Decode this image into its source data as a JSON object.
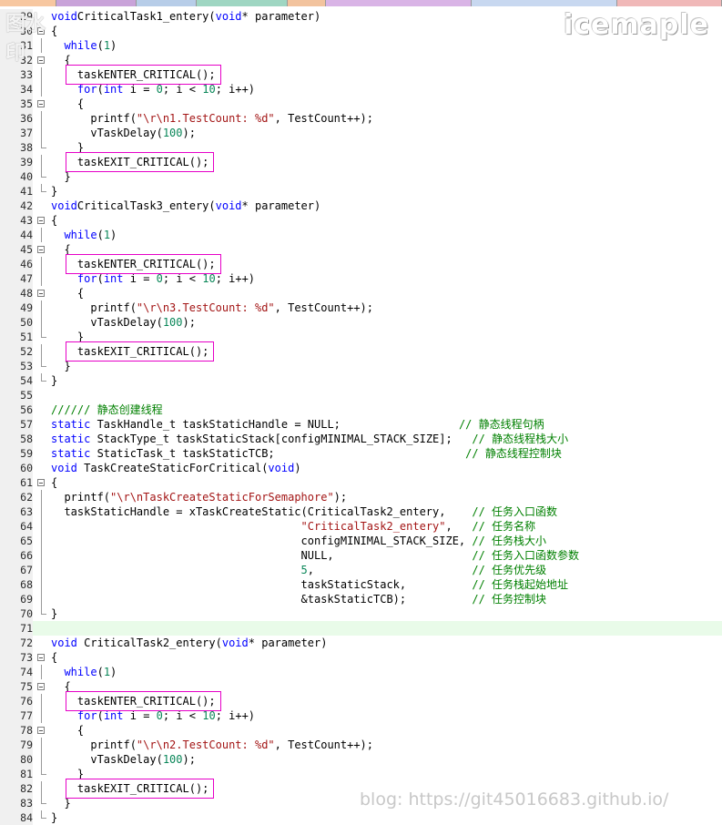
{
  "tabs_colors": [
    "#f7c7a0",
    "#c9a3d9",
    "#b7cde8",
    "#9fd6c2",
    "#f2c39e",
    "#d9b4e6",
    "#c8d8f0",
    "#f0b8b8"
  ],
  "watermark": {
    "logo": "icemaple",
    "corner": "图水印",
    "blog": "blog: https://git45016683.github.io/"
  },
  "highlight_line": 71,
  "lines": [
    {
      "n": "29",
      "fold": "none",
      "code": [
        [
          "kw",
          "void"
        ],
        [
          "",
          "CriticalTask1_entery("
        ],
        [
          "kw",
          "void"
        ],
        [
          "",
          "* parameter)"
        ]
      ]
    },
    {
      "n": "30",
      "fold": "box",
      "code": [
        [
          "",
          "{"
        ]
      ]
    },
    {
      "n": "31",
      "fold": "vl",
      "code": [
        [
          "",
          "  "
        ],
        [
          "kw",
          "while"
        ],
        [
          "",
          "("
        ],
        [
          "num",
          "1"
        ],
        [
          "",
          ")"
        ]
      ]
    },
    {
      "n": "32",
      "fold": "box",
      "code": [
        [
          "",
          "  {"
        ]
      ]
    },
    {
      "n": "33",
      "fold": "vl",
      "code": [
        [
          "",
          "    taskENTER_CRITICAL();"
        ]
      ]
    },
    {
      "n": "34",
      "fold": "vl",
      "code": [
        [
          "",
          "    "
        ],
        [
          "kw",
          "for"
        ],
        [
          "",
          "("
        ],
        [
          "kw",
          "int"
        ],
        [
          "",
          " i = "
        ],
        [
          "num",
          "0"
        ],
        [
          "",
          "; i < "
        ],
        [
          "num",
          "10"
        ],
        [
          "",
          "; i++)"
        ]
      ]
    },
    {
      "n": "35",
      "fold": "box",
      "code": [
        [
          "",
          "    {"
        ]
      ]
    },
    {
      "n": "36",
      "fold": "vl",
      "code": [
        [
          "",
          "      printf("
        ],
        [
          "str",
          "\"\\r\\n1.TestCount: %d\""
        ],
        [
          "",
          ", TestCount++);"
        ]
      ]
    },
    {
      "n": "37",
      "fold": "vl",
      "code": [
        [
          "",
          "      vTaskDelay("
        ],
        [
          "num",
          "100"
        ],
        [
          "",
          ");"
        ]
      ]
    },
    {
      "n": "38",
      "fold": "end",
      "code": [
        [
          "",
          "    }"
        ]
      ]
    },
    {
      "n": "39",
      "fold": "vl",
      "code": [
        [
          "",
          "    taskEXIT_CRITICAL();"
        ]
      ]
    },
    {
      "n": "40",
      "fold": "end",
      "code": [
        [
          "",
          "  }"
        ]
      ]
    },
    {
      "n": "41",
      "fold": "end",
      "code": [
        [
          "",
          "}"
        ]
      ]
    },
    {
      "n": "42",
      "fold": "none",
      "code": [
        [
          "kw",
          "void"
        ],
        [
          "",
          "CriticalTask3_entery("
        ],
        [
          "kw",
          "void"
        ],
        [
          "",
          "* parameter)"
        ]
      ]
    },
    {
      "n": "43",
      "fold": "box",
      "code": [
        [
          "",
          "{"
        ]
      ]
    },
    {
      "n": "44",
      "fold": "vl",
      "code": [
        [
          "",
          "  "
        ],
        [
          "kw",
          "while"
        ],
        [
          "",
          "("
        ],
        [
          "num",
          "1"
        ],
        [
          "",
          ")"
        ]
      ]
    },
    {
      "n": "45",
      "fold": "box",
      "code": [
        [
          "",
          "  {"
        ]
      ]
    },
    {
      "n": "46",
      "fold": "vl",
      "code": [
        [
          "",
          "    taskENTER_CRITICAL();"
        ]
      ]
    },
    {
      "n": "47",
      "fold": "vl",
      "code": [
        [
          "",
          "    "
        ],
        [
          "kw",
          "for"
        ],
        [
          "",
          "("
        ],
        [
          "kw",
          "int"
        ],
        [
          "",
          "",
          " i = "
        ],
        [
          "num",
          "0"
        ],
        [
          "",
          "; i < "
        ],
        [
          "num",
          "10"
        ],
        [
          "",
          "; i++)"
        ]
      ]
    },
    {
      "n": "48",
      "fold": "box",
      "code": [
        [
          "",
          "    {"
        ]
      ]
    },
    {
      "n": "49",
      "fold": "vl",
      "code": [
        [
          "",
          "      printf("
        ],
        [
          "str",
          "\"\\r\\n3.TestCount: %d\""
        ],
        [
          "",
          ", TestCount++);"
        ]
      ]
    },
    {
      "n": "50",
      "fold": "vl",
      "code": [
        [
          "",
          "      vTaskDelay("
        ],
        [
          "num",
          "100"
        ],
        [
          "",
          ");"
        ]
      ]
    },
    {
      "n": "51",
      "fold": "end",
      "code": [
        [
          "",
          "    }"
        ]
      ]
    },
    {
      "n": "52",
      "fold": "vl",
      "code": [
        [
          "",
          "    taskEXIT_CRITICAL();"
        ]
      ]
    },
    {
      "n": "53",
      "fold": "end",
      "code": [
        [
          "",
          "  }"
        ]
      ]
    },
    {
      "n": "54",
      "fold": "end",
      "code": [
        [
          "",
          "}"
        ]
      ]
    },
    {
      "n": "55",
      "fold": "none",
      "code": []
    },
    {
      "n": "56",
      "fold": "none",
      "code": [
        [
          "cm",
          "////// 静态创建线程"
        ]
      ]
    },
    {
      "n": "57",
      "fold": "none",
      "code": [
        [
          "kw",
          "static"
        ],
        [
          "",
          " TaskHandle_t taskStaticHandle = NULL;                  "
        ],
        [
          "cm",
          "// 静态线程句柄"
        ]
      ]
    },
    {
      "n": "58",
      "fold": "none",
      "code": [
        [
          "kw",
          "static"
        ],
        [
          "",
          " StackType_t taskStaticStack[configMINIMAL_STACK_SIZE];   "
        ],
        [
          "cm",
          "// 静态线程栈大小"
        ]
      ]
    },
    {
      "n": "59",
      "fold": "none",
      "code": [
        [
          "kw",
          "static"
        ],
        [
          "",
          " StaticTask_t taskStaticTCB;                             "
        ],
        [
          "cm",
          "// 静态线程控制块"
        ]
      ]
    },
    {
      "n": "60",
      "fold": "none",
      "code": [
        [
          "kw",
          "void"
        ],
        [
          "",
          " TaskCreateStaticForCritical("
        ],
        [
          "kw",
          "void"
        ],
        [
          "",
          ")"
        ]
      ]
    },
    {
      "n": "61",
      "fold": "box",
      "code": [
        [
          "",
          "{"
        ]
      ]
    },
    {
      "n": "62",
      "fold": "vl",
      "code": [
        [
          "",
          "  printf("
        ],
        [
          "str",
          "\"\\r\\nTaskCreateStaticForSemaphore\""
        ],
        [
          "",
          ");"
        ]
      ]
    },
    {
      "n": "63",
      "fold": "vl",
      "code": [
        [
          "",
          "  taskStaticHandle = xTaskCreateStatic(CriticalTask2_entery,    "
        ],
        [
          "cm",
          "// 任务入口函数"
        ]
      ]
    },
    {
      "n": "64",
      "fold": "vl",
      "code": [
        [
          "",
          "                                      "
        ],
        [
          "str",
          "\"CriticalTask2_entery\""
        ],
        [
          "",
          ",   "
        ],
        [
          "cm",
          "// 任务名称"
        ]
      ]
    },
    {
      "n": "65",
      "fold": "vl",
      "code": [
        [
          "",
          "                                      configMINIMAL_STACK_SIZE, "
        ],
        [
          "cm",
          "// 任务栈大小"
        ]
      ]
    },
    {
      "n": "66",
      "fold": "vl",
      "code": [
        [
          "",
          "                                      NULL,                     "
        ],
        [
          "cm",
          "// 任务入口函数参数"
        ]
      ]
    },
    {
      "n": "67",
      "fold": "vl",
      "code": [
        [
          "",
          "                                      "
        ],
        [
          "num",
          "5"
        ],
        [
          "",
          ",                        "
        ],
        [
          "cm",
          "// 任务优先级"
        ]
      ]
    },
    {
      "n": "68",
      "fold": "vl",
      "code": [
        [
          "",
          "                                      taskStaticStack,          "
        ],
        [
          "cm",
          "// 任务栈起始地址"
        ]
      ]
    },
    {
      "n": "69",
      "fold": "vl",
      "code": [
        [
          "",
          "                                      &taskStaticTCB);          "
        ],
        [
          "cm",
          "// 任务控制块"
        ]
      ]
    },
    {
      "n": "70",
      "fold": "end",
      "code": [
        [
          "",
          "}"
        ]
      ]
    },
    {
      "n": "71",
      "fold": "none",
      "code": []
    },
    {
      "n": "72",
      "fold": "none",
      "code": [
        [
          "kw",
          "void"
        ],
        [
          "",
          " CriticalTask2_entery("
        ],
        [
          "kw",
          "void"
        ],
        [
          "",
          "* parameter)"
        ]
      ]
    },
    {
      "n": "73",
      "fold": "box",
      "code": [
        [
          "",
          "{"
        ]
      ]
    },
    {
      "n": "74",
      "fold": "vl",
      "code": [
        [
          "",
          "  "
        ],
        [
          "kw",
          "while"
        ],
        [
          "",
          "("
        ],
        [
          "num",
          "1"
        ],
        [
          "",
          ")"
        ]
      ]
    },
    {
      "n": "75",
      "fold": "box",
      "code": [
        [
          "",
          "  {"
        ]
      ]
    },
    {
      "n": "76",
      "fold": "vl",
      "code": [
        [
          "",
          "    taskENTER_CRITICAL();"
        ]
      ]
    },
    {
      "n": "77",
      "fold": "vl",
      "code": [
        [
          "",
          "    "
        ],
        [
          "kw",
          "for"
        ],
        [
          "",
          "("
        ],
        [
          "kw",
          "int"
        ],
        [
          "",
          " i = "
        ],
        [
          "num",
          "0"
        ],
        [
          "",
          "; i < "
        ],
        [
          "num",
          "10"
        ],
        [
          "",
          "; i++)"
        ]
      ]
    },
    {
      "n": "78",
      "fold": "box",
      "code": [
        [
          "",
          "    {"
        ]
      ]
    },
    {
      "n": "79",
      "fold": "vl",
      "code": [
        [
          "",
          "      printf("
        ],
        [
          "str",
          "\"\\r\\n2.TestCount: %d\""
        ],
        [
          "",
          ", TestCount++);"
        ]
      ]
    },
    {
      "n": "80",
      "fold": "vl",
      "code": [
        [
          "",
          "      vTaskDelay("
        ],
        [
          "num",
          "100"
        ],
        [
          "",
          ");"
        ]
      ]
    },
    {
      "n": "81",
      "fold": "end",
      "code": [
        [
          "",
          "    }"
        ]
      ]
    },
    {
      "n": "82",
      "fold": "vl",
      "code": [
        [
          "",
          "    taskEXIT_CRITICAL();"
        ]
      ]
    },
    {
      "n": "83",
      "fold": "end",
      "code": [
        [
          "",
          "  }"
        ]
      ]
    },
    {
      "n": "84",
      "fold": "end",
      "code": [
        [
          "",
          "}"
        ]
      ]
    }
  ],
  "marked_lines": [
    "33",
    "39",
    "46",
    "52",
    "76",
    "82"
  ]
}
